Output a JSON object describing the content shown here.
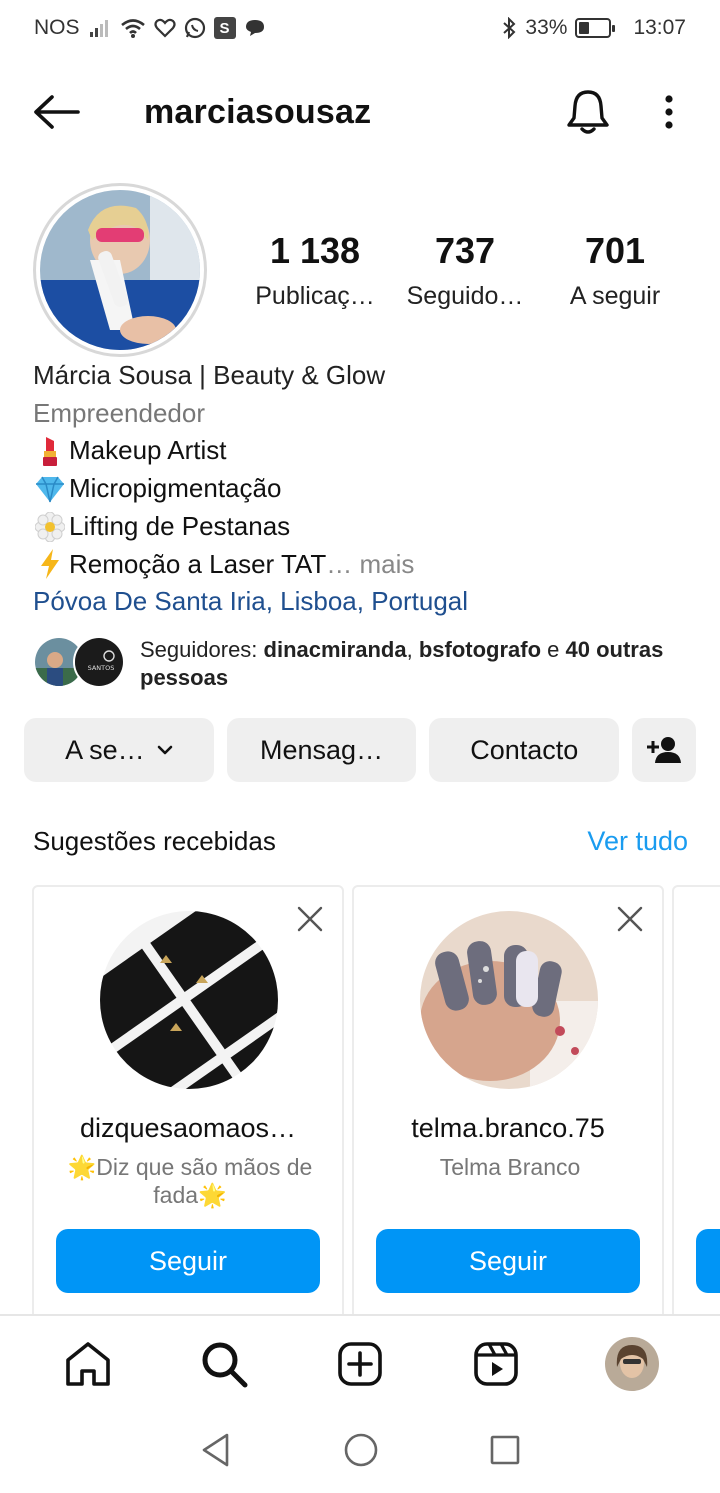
{
  "status_bar": {
    "carrier": "NOS",
    "battery_percent": "33%",
    "battery_level": 0.33,
    "time": "13:07",
    "notification_icons": [
      "signal-icon",
      "wifi-icon",
      "heart-icon",
      "whatsapp-icon",
      "s-app-icon",
      "chat-icon"
    ],
    "bluetooth": "bluetooth-icon"
  },
  "header": {
    "username": "marciasousaz"
  },
  "profile": {
    "stats": [
      {
        "value": "1 138",
        "label": "Publicaç…"
      },
      {
        "value": "737",
        "label": "Seguido…"
      },
      {
        "value": "701",
        "label": "A seguir"
      }
    ],
    "name": "Márcia Sousa | Beauty & Glow",
    "category": "Empreendedor",
    "bio_lines": [
      {
        "emoji": "💄",
        "text": "Makeup Artist"
      },
      {
        "emoji": "💎",
        "text": "Micropigmentação"
      },
      {
        "emoji": "🌼",
        "text": "Lifting de Pestanas"
      },
      {
        "emoji": "⚡",
        "text": "Remoção a Laser TAT"
      }
    ],
    "more_label": "… mais",
    "location": "Póvoa De Santa Iria, Lisboa, Portugal",
    "followers": {
      "prefix": "Seguidores: ",
      "name1": "dinacmiranda",
      "sep": ", ",
      "name2": "bsfotografo",
      "and": " e ",
      "rest": "40 outras pessoas",
      "mini_avatar_2_label": "SANTOS"
    }
  },
  "actions": {
    "follow_label": "A se…",
    "message_label": "Mensag…",
    "contact_label": "Contacto"
  },
  "suggestions": {
    "title": "Sugestões recebidas",
    "see_all": "Ver tudo",
    "cards": [
      {
        "username": "dizquesaomaos…",
        "subtitle": "🌟Diz que são mãos de fada🌟",
        "follow_label": "Seguir"
      },
      {
        "username": "telma.branco.75",
        "subtitle": "Telma Branco",
        "follow_label": "Seguir"
      }
    ]
  },
  "colors": {
    "primary_blue": "#0095f6",
    "link_blue": "#1a9cf0",
    "location_blue": "#1f4f8f",
    "button_gray": "#efefef"
  }
}
